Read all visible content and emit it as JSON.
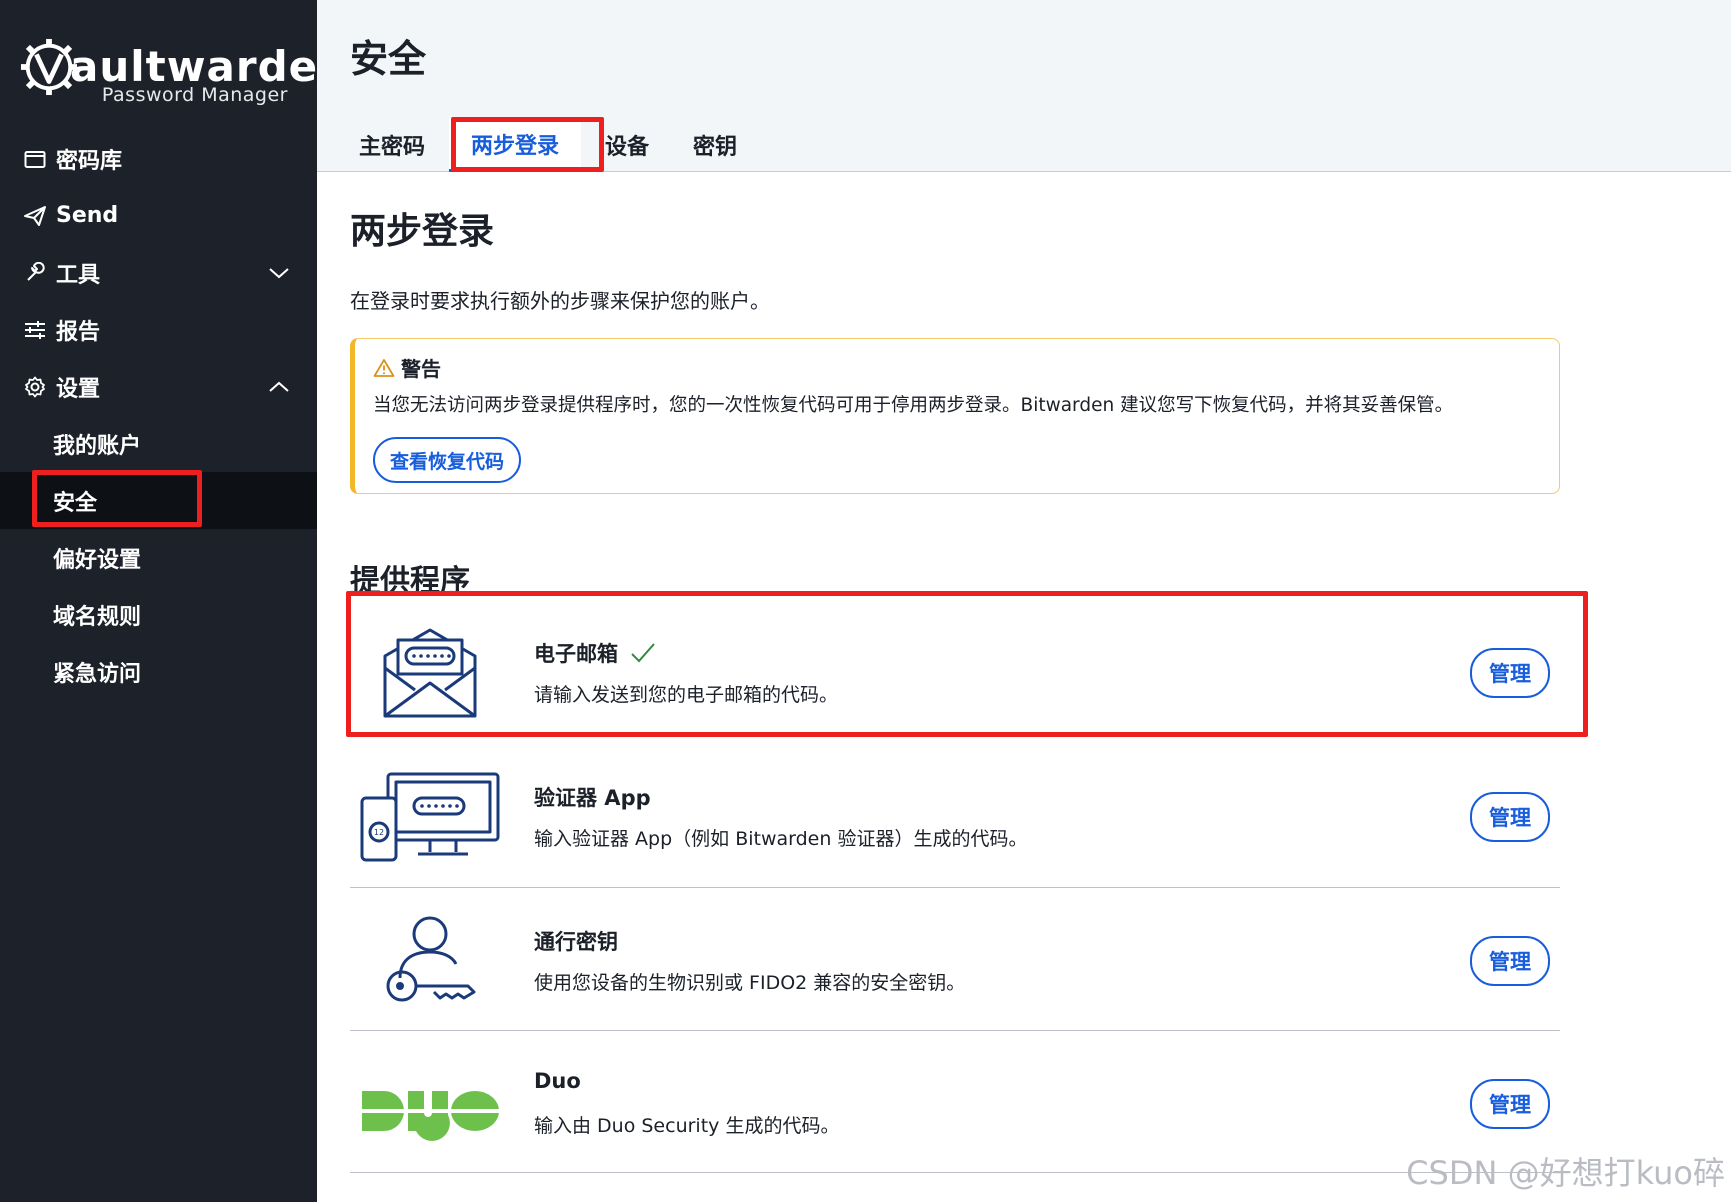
{
  "brand": {
    "name_bold": "aultwarden",
    "name_prefix": "V",
    "subtitle": "Password Manager"
  },
  "sidebar": {
    "items": [
      {
        "label": "密码库",
        "icon": "vault-icon"
      },
      {
        "label": "Send",
        "icon": "send-icon"
      },
      {
        "label": "工具",
        "icon": "wrench-icon"
      },
      {
        "label": "报告",
        "icon": "sliders-icon"
      },
      {
        "label": "设置",
        "icon": "gear-icon"
      }
    ],
    "settings_children": [
      {
        "label": "我的账户"
      },
      {
        "label": "安全"
      },
      {
        "label": "偏好设置"
      },
      {
        "label": "域名规则"
      },
      {
        "label": "紧急访问"
      }
    ]
  },
  "header": {
    "title": "安全",
    "tabs": [
      {
        "label": "主密码"
      },
      {
        "label": "两步登录"
      },
      {
        "label": "设备"
      },
      {
        "label": "密钥"
      }
    ]
  },
  "main": {
    "title": "两步登录",
    "description": "在登录时要求执行额外的步骤来保护您的账户。",
    "warning": {
      "title": "警告",
      "body": "当您无法访问两步登录提供程序时，您的一次性恢复代码可用于停用两步登录。Bitwarden 建议您写下恢复代码，并将其妥善保管。",
      "button": "查看恢复代码"
    },
    "providers_title": "提供程序",
    "providers": [
      {
        "name": "电子邮箱",
        "desc": "请输入发送到您的电子邮箱的代码。",
        "button": "管理",
        "enabled": true
      },
      {
        "name": "验证器 App",
        "desc": "输入验证器 App（例如 Bitwarden 验证器）生成的代码。",
        "button": "管理",
        "enabled": false
      },
      {
        "name": "通行密钥",
        "desc": "使用您设备的生物识别或 FIDO2 兼容的安全密钥。",
        "button": "管理",
        "enabled": false
      },
      {
        "name": "Duo",
        "desc": "输入由 Duo Security 生成的代码。",
        "button": "管理",
        "enabled": false
      }
    ]
  },
  "watermark": "CSDN @好想打kuo碎",
  "colors": {
    "sidebar_bg": "#1d222a",
    "accent": "#175ddc",
    "highlight_red": "#ee1f1f",
    "warning": "#f3b72a",
    "duo_green": "#6dc04b",
    "check_green": "#2e8b3d"
  }
}
